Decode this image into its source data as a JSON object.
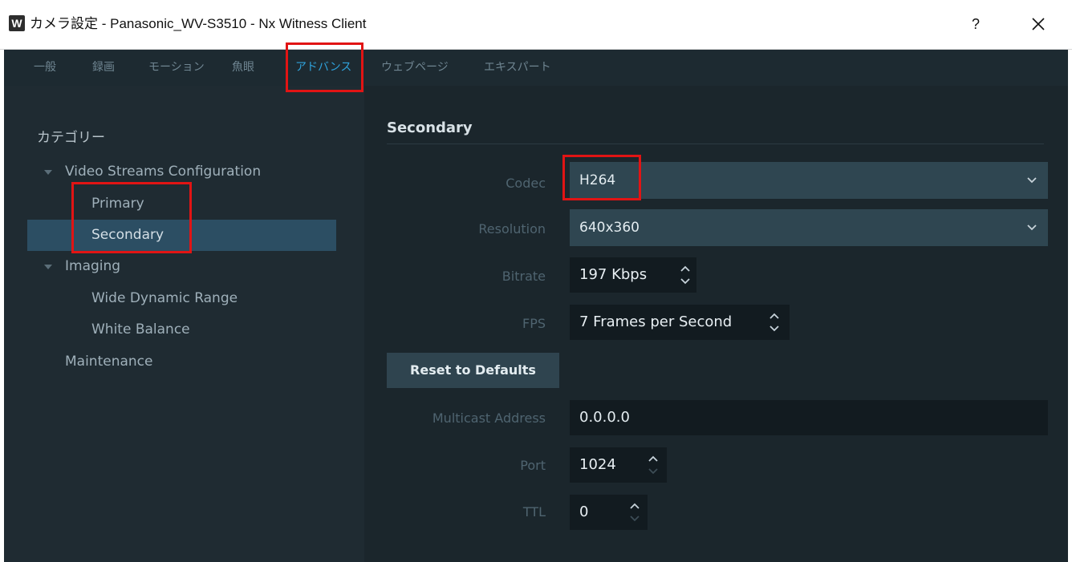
{
  "window": {
    "icon_letter": "W",
    "title": "カメラ設定 - Panasonic_WV-S3510 - Nx Witness Client",
    "help_label": "?",
    "close_icon": "close-icon"
  },
  "tabs": [
    {
      "label": "一般"
    },
    {
      "label": "録画"
    },
    {
      "label": "モーション"
    },
    {
      "label": "魚眼"
    },
    {
      "label": "アドバンス",
      "active": true
    },
    {
      "label": "ウェブページ"
    },
    {
      "label": "エキスパート"
    }
  ],
  "sidebar": {
    "title": "カテゴリー",
    "tree": [
      {
        "label": "Video Streams Configuration",
        "expanded": true
      },
      {
        "label": "Primary"
      },
      {
        "label": "Secondary",
        "selected": true
      },
      {
        "label": "Imaging",
        "expanded": true
      },
      {
        "label": "Wide Dynamic Range"
      },
      {
        "label": "White Balance"
      },
      {
        "label": "Maintenance"
      }
    ]
  },
  "main": {
    "section_title": "Secondary",
    "codec": {
      "label": "Codec",
      "value": "H264"
    },
    "resolution": {
      "label": "Resolution",
      "value": "640x360"
    },
    "bitrate": {
      "label": "Bitrate",
      "value": "197 Kbps"
    },
    "fps": {
      "label": "FPS",
      "value": "7 Frames per Second"
    },
    "reset_label": "Reset to Defaults",
    "multicast": {
      "label": "Multicast Address",
      "value": "0.0.0.0"
    },
    "port": {
      "label": "Port",
      "value": "1024"
    },
    "ttl": {
      "label": "TTL",
      "value": "0"
    }
  },
  "colors": {
    "highlight": "#e11414",
    "active_tab": "#2fa2db",
    "selection": "#2c4e63"
  }
}
